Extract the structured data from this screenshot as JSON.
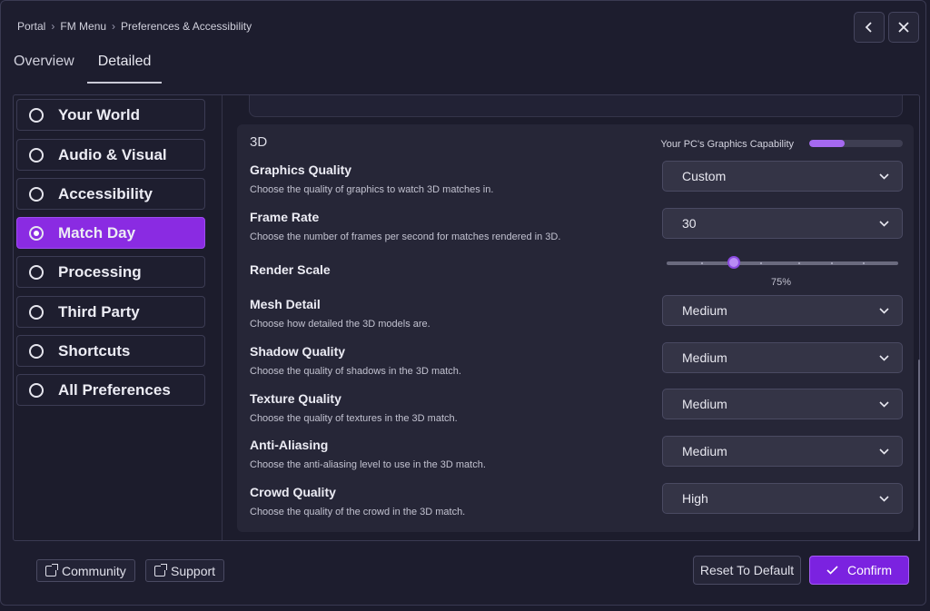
{
  "breadcrumb": [
    "Portal",
    "FM Menu",
    "Preferences & Accessibility"
  ],
  "tabs": [
    {
      "label": "Overview",
      "active": false
    },
    {
      "label": "Detailed",
      "active": true
    }
  ],
  "sidebar": {
    "items": [
      {
        "label": "Your World",
        "selected": false
      },
      {
        "label": "Audio & Visual",
        "selected": false
      },
      {
        "label": "Accessibility",
        "selected": false
      },
      {
        "label": "Match Day",
        "selected": true
      },
      {
        "label": "Processing",
        "selected": false
      },
      {
        "label": "Third Party",
        "selected": false
      },
      {
        "label": "Shortcuts",
        "selected": false
      },
      {
        "label": "All Preferences",
        "selected": false
      }
    ]
  },
  "section": {
    "title": "3D",
    "capability": {
      "label": "Your PC's Graphics Capability",
      "level_fraction": 0.38
    },
    "settings": [
      {
        "title": "Graphics Quality",
        "description": "Choose the quality of graphics to watch 3D matches in.",
        "value": "Custom"
      },
      {
        "title": "Frame Rate",
        "description": "Choose the number of frames per second for matches rendered in 3D.",
        "value": "30"
      },
      {
        "title": "Mesh Detail",
        "description": "Choose how detailed the 3D models are.",
        "value": "Medium"
      },
      {
        "title": "Shadow Quality",
        "description": "Choose the quality of shadows in the 3D match.",
        "value": "Medium"
      },
      {
        "title": "Texture Quality",
        "description": "Choose the quality of textures in the 3D match.",
        "value": "Medium"
      },
      {
        "title": "Anti-Aliasing",
        "description": "Choose the anti-aliasing level to use in the 3D match.",
        "value": "Medium"
      },
      {
        "title": "Crowd Quality",
        "description": "Choose the quality of the crowd in the 3D match.",
        "value": "High"
      }
    ],
    "render_scale": {
      "title": "Render Scale",
      "value_label": "75%",
      "value_fraction": 0.29
    }
  },
  "footer": {
    "community_label": "Community",
    "support_label": "Support",
    "reset_label": "Reset To Default",
    "confirm_label": "Confirm"
  },
  "colors": {
    "accent": "#8a2be2",
    "background": "#1d1d2e",
    "card": "#262637"
  },
  "icons": {
    "back": "chevron-left-icon",
    "close": "close-icon",
    "dropdown": "chevron-down-icon",
    "external": "external-link-icon",
    "confirm": "check-icon"
  }
}
